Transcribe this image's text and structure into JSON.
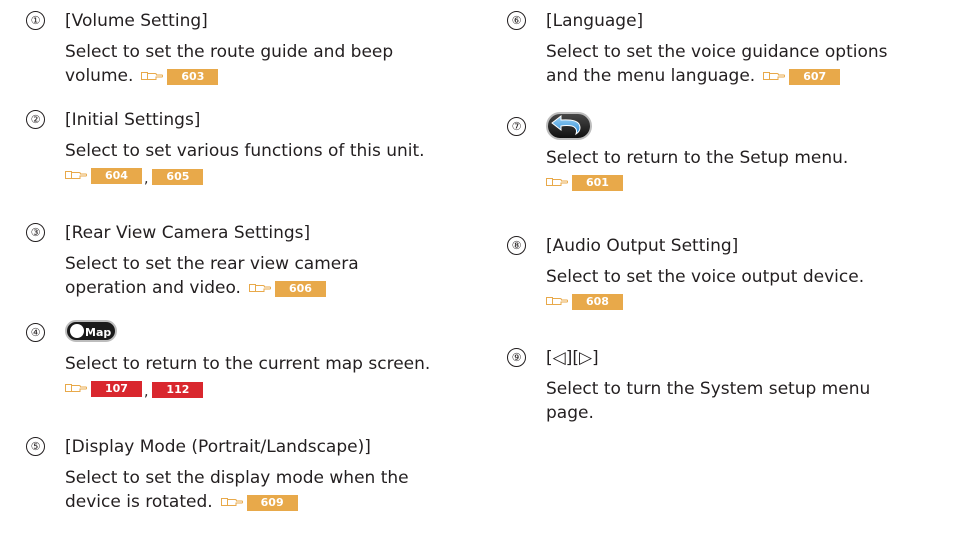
{
  "colors": {
    "ref_default": "#e8a94a",
    "ref_highlight": "#d9272e",
    "text": "#231f20"
  },
  "items": [
    {
      "number": "①",
      "title": "[Volume Setting]",
      "desc_lines": [
        "Select to set the route guide and beep",
        "volume."
      ],
      "refs": [
        "603"
      ]
    },
    {
      "number": "②",
      "title": "[Initial Settings]",
      "desc_lines": [
        "Select to set various functions of this unit."
      ],
      "refs": [
        "604",
        "605"
      ]
    },
    {
      "number": "③",
      "title": "[Rear View Camera Settings]",
      "desc_lines": [
        "Select to set the rear view camera",
        "operation and video."
      ],
      "refs": [
        "606"
      ]
    },
    {
      "number": "④",
      "icon": "map-button-icon",
      "icon_label": "Map",
      "desc_lines": [
        "Select to return to the current map screen."
      ],
      "refs": [
        "107",
        "112"
      ]
    },
    {
      "number": "⑤",
      "title": "[Display Mode (Portrait/Landscape)]",
      "desc_lines": [
        "Select to set the display mode when the",
        "device is rotated."
      ],
      "refs": [
        "609"
      ]
    },
    {
      "number": "⑥",
      "title": "[Language]",
      "desc_lines": [
        "Select to set the voice guidance options",
        "and the menu language."
      ],
      "refs": [
        "607"
      ]
    },
    {
      "number": "⑦",
      "icon": "back-arrow-icon",
      "desc_lines": [
        "Select to return to the Setup menu."
      ],
      "refs": [
        "601"
      ]
    },
    {
      "number": "⑧",
      "title": "[Audio Output Setting]",
      "desc_lines": [
        "Select to set the voice output device."
      ],
      "refs": [
        "608"
      ]
    },
    {
      "number": "⑨",
      "title": "[◁][▷]",
      "desc_lines": [
        "Select to turn the System setup menu",
        "page."
      ]
    }
  ]
}
